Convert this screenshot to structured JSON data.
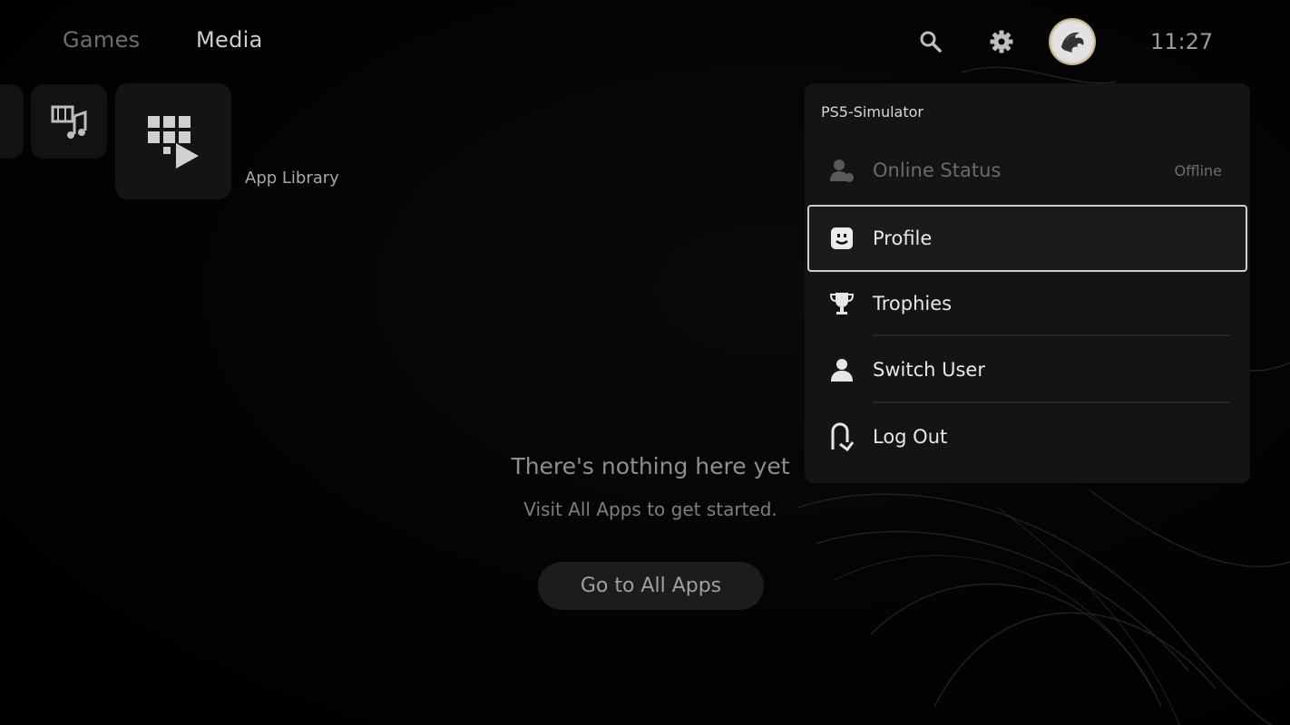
{
  "nav": {
    "tabs": [
      {
        "label": "Games"
      },
      {
        "label": "Media"
      }
    ],
    "clock": "11:27",
    "icons": {
      "search": "search-icon",
      "settings": "gear-icon",
      "avatar": "avatar"
    }
  },
  "tiles": {
    "library_label": "App Library"
  },
  "empty_state": {
    "title": "There's nothing here yet",
    "subtitle": "Visit All Apps to get started.",
    "button": "Go to All Apps"
  },
  "profile_menu": {
    "username": "PS5-Simulator",
    "items": [
      {
        "label": "Online Status",
        "value": "Offline",
        "icon": "online-status-icon"
      },
      {
        "label": "Profile",
        "icon": "profile-icon",
        "selected": true
      },
      {
        "label": "Trophies",
        "icon": "trophy-icon"
      },
      {
        "label": "Switch User",
        "icon": "user-icon"
      },
      {
        "label": "Log Out",
        "icon": "log-out-icon"
      }
    ]
  },
  "colors": {
    "background": "#000000",
    "menu_bg": "#141416",
    "focus_border": "#cfcfcf",
    "avatar_ring": "#c9b27a"
  }
}
